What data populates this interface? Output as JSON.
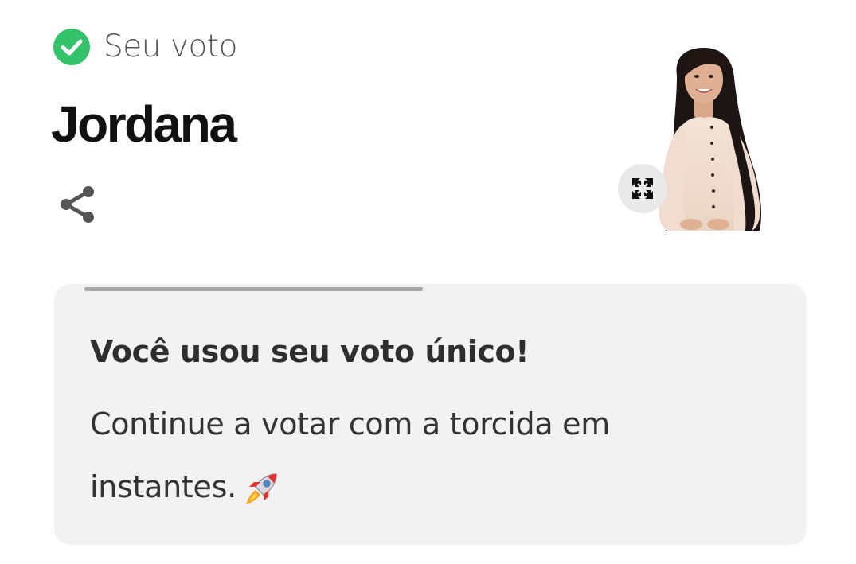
{
  "vote_status": {
    "label": "Seu voto",
    "icon": "check-circle-icon",
    "color": "#34c26b"
  },
  "candidate": {
    "name": "Jordana",
    "photo_icon": "candidate-photo"
  },
  "actions": {
    "share_icon": "share-icon",
    "expand_icon": "expand-icon"
  },
  "message": {
    "title": "Você usou seu voto único!",
    "body": "Continue a votar com a torcida em instantes.",
    "emoji_icon": "rocket-icon"
  },
  "progress": {
    "fraction": 0.45
  }
}
